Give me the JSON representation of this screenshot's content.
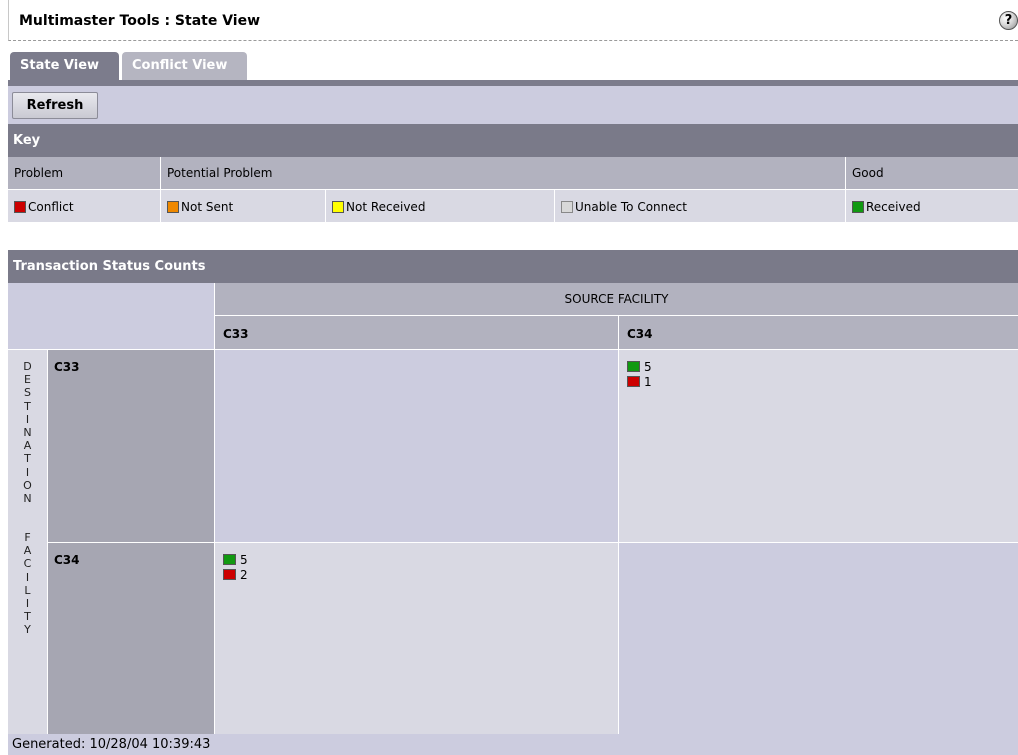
{
  "window": {
    "title": "Multimaster Tools : State View",
    "help_glyph": "?"
  },
  "tabs": [
    {
      "label": "State View",
      "active": true
    },
    {
      "label": "Conflict View",
      "active": false
    }
  ],
  "toolbar": {
    "refresh_label": "Refresh"
  },
  "key": {
    "title": "Key",
    "groups": {
      "problem": "Problem",
      "potential_problem": "Potential Problem",
      "good": "Good"
    },
    "items": {
      "conflict": {
        "label": "Conflict",
        "color": "#cc0000"
      },
      "not_sent": {
        "label": "Not Sent",
        "color": "#ee8800"
      },
      "not_received": {
        "label": "Not Received",
        "color": "#ffff00"
      },
      "unable_to_connect": {
        "label": "Unable To Connect",
        "color": "#d8d8d8"
      },
      "received": {
        "label": "Received",
        "color": "#119911"
      }
    }
  },
  "counts": {
    "title": "Transaction Status Counts",
    "source_label": "SOURCE FACILITY",
    "destination_label": "DESTINATION FACILITY",
    "columns": [
      "C33",
      "C34"
    ],
    "rows": [
      "C33",
      "C34"
    ],
    "cells": {
      "c33_to_c34": {
        "received": "5",
        "conflict": "1"
      },
      "c34_to_c33": {
        "received": "5",
        "conflict": "2"
      }
    }
  },
  "footer": {
    "generated": "Generated: 10/28/04 10:39:43"
  }
}
